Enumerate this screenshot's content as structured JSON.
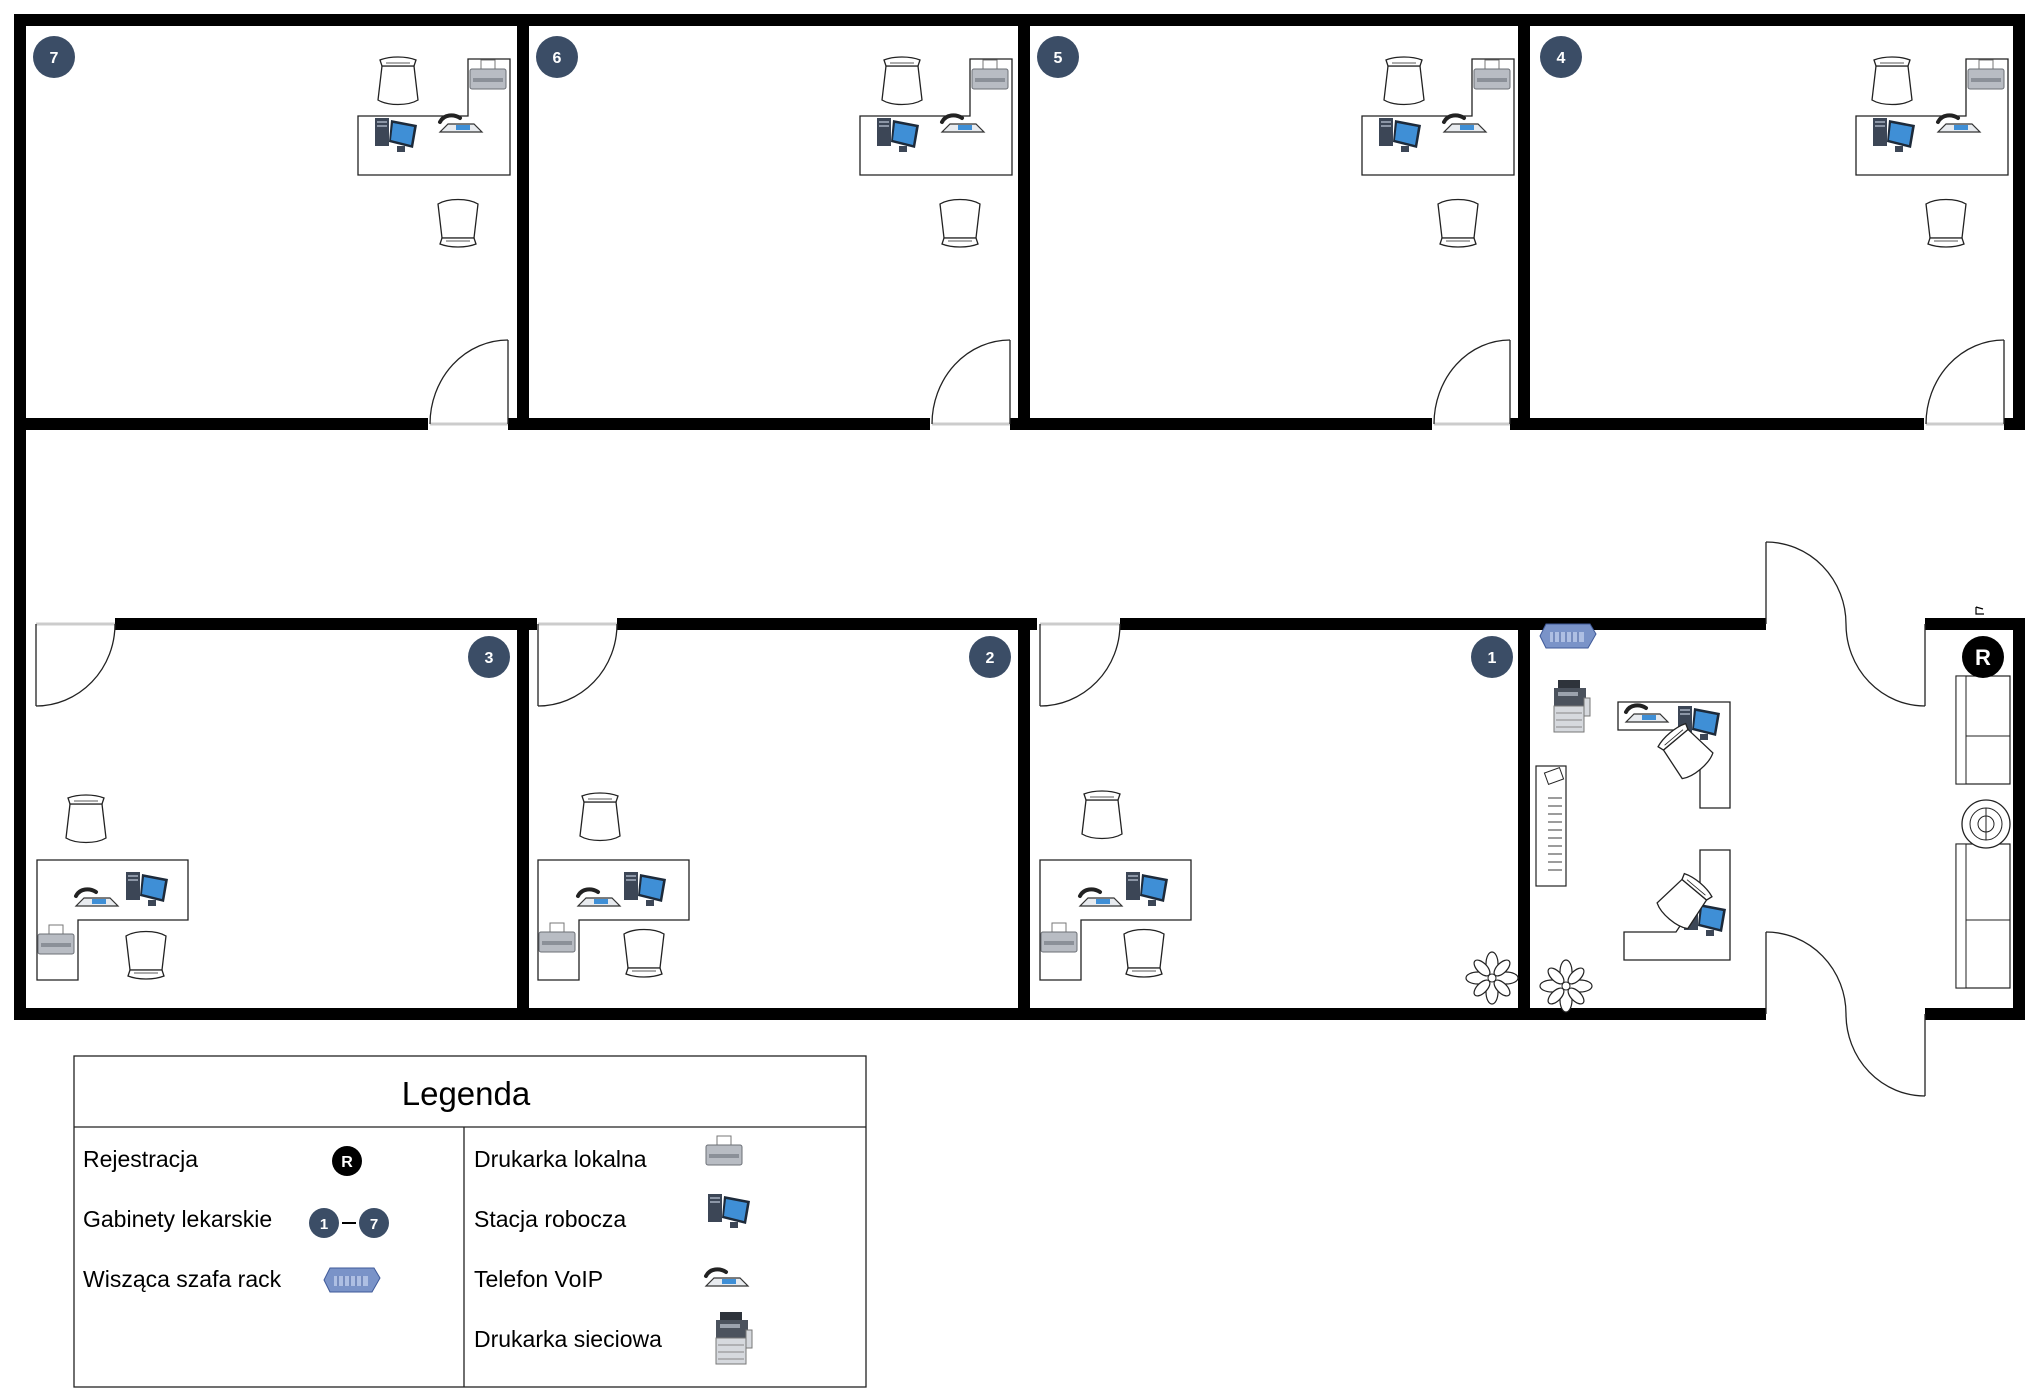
{
  "rooms": [
    {
      "id": "room-1",
      "number": "1"
    },
    {
      "id": "room-2",
      "number": "2"
    },
    {
      "id": "room-3",
      "number": "3"
    },
    {
      "id": "room-4",
      "number": "4"
    },
    {
      "id": "room-5",
      "number": "5"
    },
    {
      "id": "room-6",
      "number": "6"
    },
    {
      "id": "room-7",
      "number": "7"
    }
  ],
  "reception": {
    "marker": "R"
  },
  "legend": {
    "title": "Legenda",
    "items": [
      {
        "label": "Rejestracja",
        "icon": "reception-marker-icon"
      },
      {
        "label": "Gabinety lekarskie",
        "icon": "room-range-icon",
        "range_from": "1",
        "range_to": "7"
      },
      {
        "label": "Wisząca szafa rack",
        "icon": "rack-icon"
      },
      {
        "label": "Drukarka lokalna",
        "icon": "local-printer-icon"
      },
      {
        "label": "Stacja robocza",
        "icon": "workstation-icon"
      },
      {
        "label": "Telefon VoIP",
        "icon": "voip-phone-icon"
      },
      {
        "label": "Drukarka sieciowa",
        "icon": "network-printer-icon"
      }
    ]
  },
  "colors": {
    "wall": "#000000",
    "badge": "#3b4d66",
    "rack": "#7a93c8",
    "screen": "#3f8fd6",
    "computer": "#3c4656",
    "printer": "#b8bcc3"
  }
}
